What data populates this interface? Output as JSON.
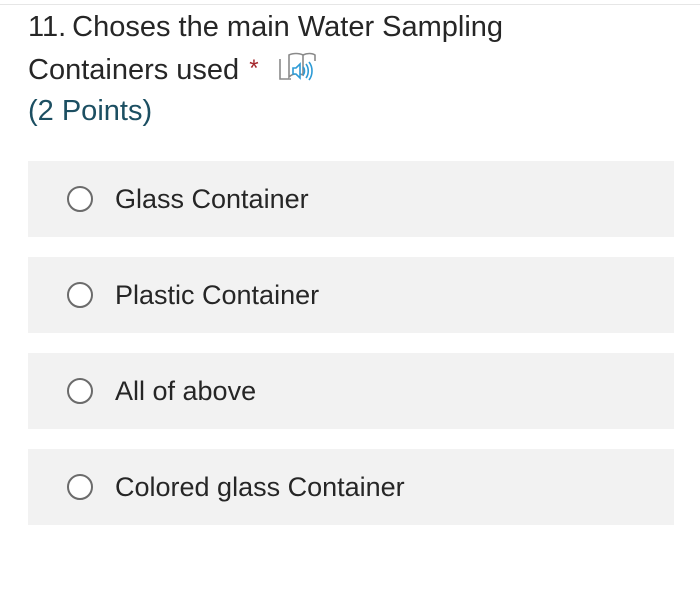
{
  "question": {
    "number": "11.",
    "text_line1": "Choses the main Water Sampling",
    "text_line2": "Containers used",
    "required_marker": "*",
    "points": "(2 Points)",
    "reader_icon": "immersive-reader-icon"
  },
  "options": [
    {
      "label": "Glass Container",
      "selected": false
    },
    {
      "label": "Plastic Container",
      "selected": false
    },
    {
      "label": "All of above",
      "selected": false
    },
    {
      "label": "Colored glass Container",
      "selected": false
    }
  ],
  "colors": {
    "points_text": "#1c4f62",
    "required": "#a4262c",
    "option_background": "#f2f2f2",
    "radio_border": "#6b6b6b",
    "icon_accent": "#2d9bd6"
  }
}
